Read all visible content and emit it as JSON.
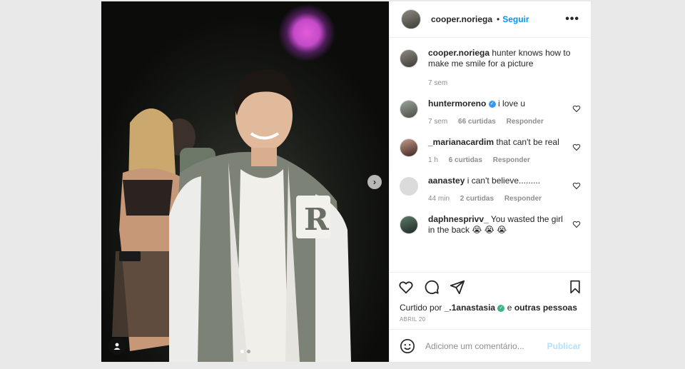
{
  "post": {
    "author": "cooper.noriega",
    "follow_label": "Seguir",
    "separator": "•",
    "more_label": "•••"
  },
  "caption": {
    "user": "cooper.noriega",
    "text": "hunter knows how to make me smile for a picture",
    "time": "7 sem"
  },
  "comments": [
    {
      "user": "huntermoreno",
      "verified": true,
      "text": "i love u",
      "time": "7 sem",
      "likes": "66 curtidas",
      "reply": "Responder"
    },
    {
      "user": "_marianacardim",
      "verified": false,
      "text": "that can't be real",
      "time": "1 h",
      "likes": "6 curtidas",
      "reply": "Responder"
    },
    {
      "user": "aanastey",
      "verified": false,
      "text": "i can't believe.........",
      "time": "44 min",
      "likes": "2 curtidas",
      "reply": "Responder"
    },
    {
      "user": "daphnesprivv_",
      "verified": false,
      "text": "You wasted the girl in the back 😭 😭 😭",
      "time": "",
      "likes": "",
      "reply": ""
    }
  ],
  "likes_line": {
    "prefix": "Curtido por",
    "user": "_.1anastasia",
    "middle": "e",
    "others": "outras pessoas"
  },
  "date": "ABRIL 20",
  "add_comment": {
    "placeholder": "Adicione um comentário...",
    "publish": "Publicar"
  },
  "carousel": {
    "count": 2,
    "active": 0
  },
  "colors": {
    "accent": "#0095f6",
    "verified": "#3897f0",
    "publish_disabled": "#b2dffc"
  }
}
